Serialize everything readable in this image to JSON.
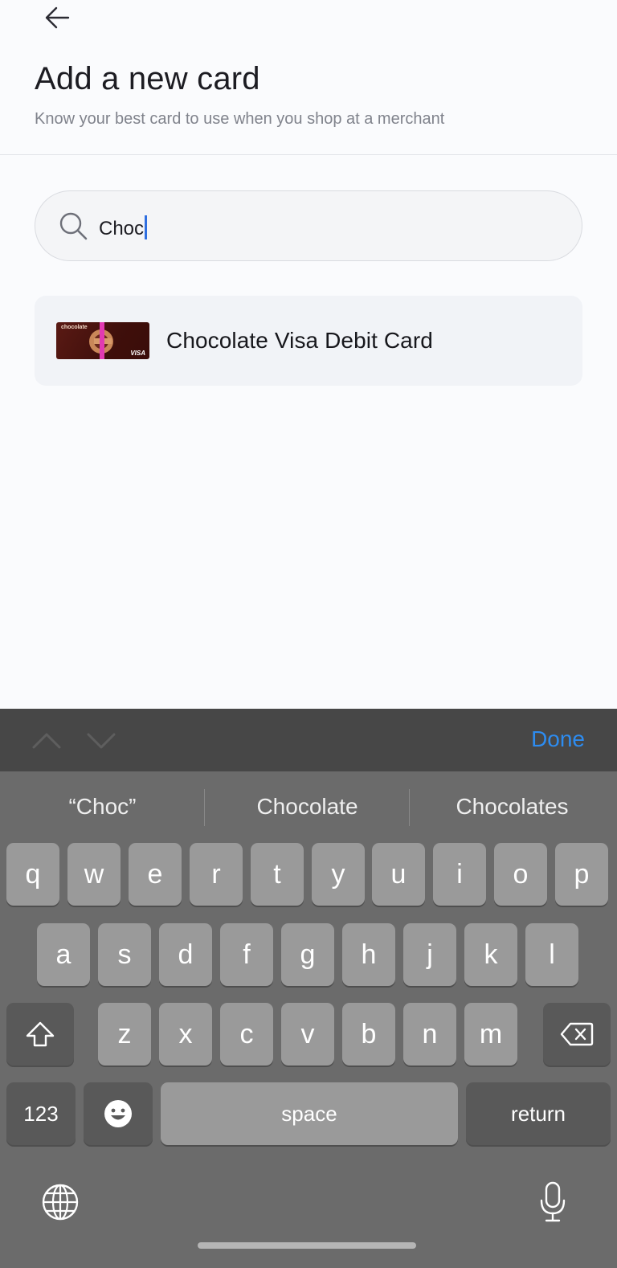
{
  "header": {
    "title": "Add a new card",
    "subtitle": "Know your best card to use when you shop at a merchant"
  },
  "search": {
    "value": "Choc",
    "placeholder": ""
  },
  "results": [
    {
      "label": "Chocolate Visa Debit Card",
      "card_brand_text": "chocolate",
      "card_network_text": "VISA"
    }
  ],
  "keyboard": {
    "done_label": "Done",
    "suggestions": [
      "“Choc”",
      "Chocolate",
      "Chocolates"
    ],
    "row1": [
      "q",
      "w",
      "e",
      "r",
      "t",
      "y",
      "u",
      "i",
      "o",
      "p"
    ],
    "row2": [
      "a",
      "s",
      "d",
      "f",
      "g",
      "h",
      "j",
      "k",
      "l"
    ],
    "row3": [
      "z",
      "x",
      "c",
      "v",
      "b",
      "n",
      "m"
    ],
    "numbers_label": "123",
    "space_label": "space",
    "return_label": "return"
  },
  "colors": {
    "accent": "#2d8cf0",
    "caret": "#2f6fe0",
    "background": "#fafbfd",
    "card_maroon": "#4a1410"
  },
  "icons": {
    "back": "arrow-left-icon",
    "search": "magnifier-icon",
    "shift": "shift-arrow-icon",
    "backspace": "backspace-icon",
    "emoji": "emoji-icon",
    "globe": "globe-icon",
    "mic": "microphone-icon"
  }
}
